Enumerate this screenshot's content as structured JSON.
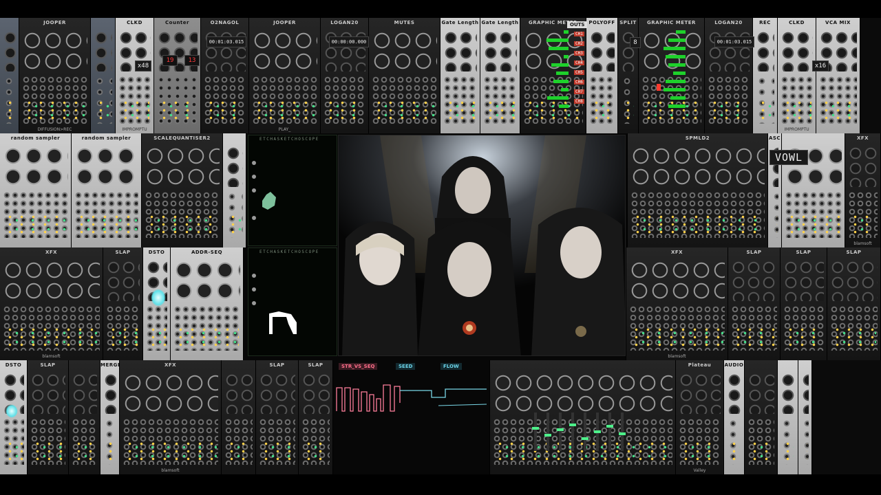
{
  "rows": {
    "row1": [
      {
        "title": "",
        "style": "steel",
        "w": 28,
        "foot": ""
      },
      {
        "title": "JOOPER",
        "style": "dark",
        "w": 104,
        "foot": "DIFFUSION>REC"
      },
      {
        "title": "",
        "style": "steel",
        "w": 36,
        "foot": ""
      },
      {
        "title": "CLKD",
        "style": "light",
        "w": 56,
        "foot": "IMPROMPTU"
      },
      {
        "title": "Counter",
        "style": "mid",
        "w": 68,
        "foot": ""
      },
      {
        "title": "O2NAGOL",
        "style": "dark",
        "w": 70,
        "foot": ""
      },
      {
        "title": "JOOPER",
        "style": "dark",
        "w": 104,
        "foot": "PLAY_"
      },
      {
        "title": "LOGAN20",
        "style": "dark",
        "w": 70,
        "foot": ""
      },
      {
        "title": "MUTES",
        "style": "dark",
        "w": 104,
        "foot": ""
      },
      {
        "title": "Gate Length",
        "style": "light",
        "w": 58,
        "foot": ""
      },
      {
        "title": "Gate Length",
        "style": "light",
        "w": 58,
        "foot": ""
      },
      {
        "title": "GRAPHIC METER",
        "style": "dark",
        "w": 96,
        "foot": ""
      },
      {
        "title": "POLYOFF",
        "style": "light",
        "w": 46,
        "foot": ""
      },
      {
        "title": "SPLIT",
        "style": "dark",
        "w": 30,
        "foot": ""
      },
      {
        "title": "GRAPHIC METER",
        "style": "dark",
        "w": 96,
        "foot": ""
      },
      {
        "title": "LOGAN20",
        "style": "dark",
        "w": 70,
        "foot": ""
      },
      {
        "title": "REC",
        "style": "light",
        "w": 36,
        "foot": ""
      },
      {
        "title": "CLKD",
        "style": "light",
        "w": 56,
        "foot": "IMPROMPTU"
      },
      {
        "title": "VCA MIX",
        "style": "light",
        "w": 64,
        "foot": ""
      }
    ],
    "row2": [
      {
        "title": "random sampler",
        "style": "light",
        "w": 104,
        "foot": ""
      },
      {
        "title": "random sampler",
        "style": "light",
        "w": 102,
        "foot": ""
      },
      {
        "title": "SCALEQUANTISER2",
        "style": "dark",
        "w": 118,
        "foot": ""
      },
      {
        "title": "",
        "style": "light",
        "w": 34,
        "foot": ""
      },
      {
        "title": "",
        "style": "black",
        "w": 554,
        "foot": ""
      },
      {
        "title": "SPMLD2",
        "style": "dark",
        "w": 204,
        "foot": ""
      },
      {
        "title": "ASC",
        "style": "light",
        "w": 20,
        "foot": ""
      },
      {
        "title": "",
        "style": "light",
        "w": 92,
        "foot": ""
      },
      {
        "title": "XFX",
        "style": "dark",
        "w": 52,
        "foot": "blamsoft"
      }
    ],
    "row3": [
      {
        "title": "XFX",
        "style": "dark",
        "w": 150,
        "foot": "blamsoft"
      },
      {
        "title": "SLAP",
        "style": "dark",
        "w": 58,
        "foot": ""
      },
      {
        "title": "DSTO",
        "style": "light",
        "w": 40,
        "foot": ""
      },
      {
        "title": "ADDR-SEQ",
        "style": "light",
        "w": 106,
        "foot": ""
      },
      {
        "title": "",
        "style": "black",
        "w": 556,
        "foot": ""
      },
      {
        "title": "XFX",
        "style": "dark",
        "w": 148,
        "foot": "blamsoft"
      },
      {
        "title": "SLAP",
        "style": "dark",
        "w": 76,
        "foot": ""
      },
      {
        "title": "SLAP",
        "style": "dark",
        "w": 68,
        "foot": ""
      },
      {
        "title": "SLAP",
        "style": "dark",
        "w": 78,
        "foot": ""
      }
    ],
    "row4": [
      {
        "title": "DSTO",
        "style": "light",
        "w": 40,
        "foot": ""
      },
      {
        "title": "SLAP",
        "style": "dark",
        "w": 60,
        "foot": ""
      },
      {
        "title": "",
        "style": "dark",
        "w": 46,
        "foot": ""
      },
      {
        "title": "MERGE",
        "style": "light",
        "w": 28,
        "foot": ""
      },
      {
        "title": "XFX",
        "style": "dark",
        "w": 148,
        "foot": "blamsoft"
      },
      {
        "title": "",
        "style": "dark",
        "w": 50,
        "foot": ""
      },
      {
        "title": "SLAP",
        "style": "dark",
        "w": 62,
        "foot": ""
      },
      {
        "title": "SLAP",
        "style": "dark",
        "w": 50,
        "foot": ""
      },
      {
        "title": "",
        "style": "black",
        "w": 228,
        "foot": ""
      },
      {
        "title": "",
        "style": "dark",
        "w": 270,
        "foot": ""
      },
      {
        "title": "Plateau",
        "style": "dark",
        "w": 70,
        "foot": "Valley"
      },
      {
        "title": "AUDIO",
        "style": "light",
        "w": 30,
        "foot": ""
      },
      {
        "title": "",
        "style": "dark",
        "w": 48,
        "foot": ""
      },
      {
        "title": "",
        "style": "light",
        "w": 30,
        "foot": ""
      },
      {
        "title": "",
        "style": "light",
        "w": 20,
        "foot": ""
      }
    ]
  },
  "readouts": {
    "counter1": "19",
    "counter2": "13",
    "clkd1": "x48",
    "clkd2": "x16",
    "o2n": "00:01:03.015",
    "logan1": "00:00:00.000",
    "logan2": "00:01:03.015",
    "vowl": "VOWL",
    "split": "8"
  },
  "meter_channels": [
    "CH1",
    "CH2",
    "CH3",
    "CH4",
    "CH5",
    "CH6",
    "CH7",
    "CH8"
  ],
  "meter_title_right": "OUTS",
  "scopes": {
    "top": "ETCHASKETCHOSCOPE",
    "bottom": "ETCHASKETCHOSCOPE"
  },
  "seq_tabs": {
    "left": "STR_VS_SEQ",
    "mid": "SEED",
    "right": "FLOW"
  },
  "colors": {
    "meter_green": "#1ed12b",
    "meter_red": "#ff3b2f",
    "scope_trace": "#b8ffd8",
    "led_yellow": "#ffd24a"
  }
}
